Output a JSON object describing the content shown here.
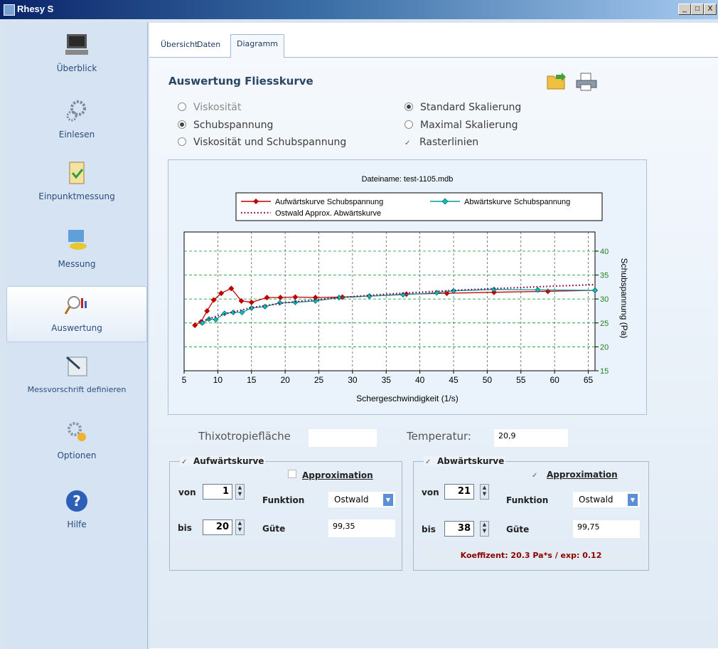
{
  "window": {
    "title": "Rhesy S",
    "controls": [
      "_",
      "□",
      "X"
    ]
  },
  "sidebar": {
    "items": [
      {
        "label": "Überblick",
        "icon": "computer-icon"
      },
      {
        "label": "Einlesen",
        "icon": "gears-icon"
      },
      {
        "label": "Einpunktmessung",
        "icon": "clipboard-check-icon"
      },
      {
        "label": "Messung",
        "icon": "measurement-icon"
      },
      {
        "label": "Auswertung",
        "icon": "analysis-chart-icon",
        "active": true
      },
      {
        "label": "Messvorschrift definieren",
        "icon": "document-pen-icon"
      },
      {
        "label": "Optionen",
        "icon": "settings-gears-icon"
      },
      {
        "label": "Hilfe",
        "icon": "help-icon"
      }
    ]
  },
  "tabs": [
    {
      "label": "Übersicht"
    },
    {
      "label": "Daten"
    },
    {
      "label": "Diagramm",
      "active": true
    }
  ],
  "content": {
    "heading": "Auswertung Fliesskurve",
    "options_left": [
      {
        "label": "Viskosität",
        "selected": false,
        "enabled": false
      },
      {
        "label": "Schubspannung",
        "selected": true,
        "enabled": true
      },
      {
        "label": "Viskosität und Schubspannung",
        "selected": false,
        "enabled": true
      }
    ],
    "options_right": [
      {
        "label": "Standard Skalierung",
        "selected": true
      },
      {
        "label": "Maximal Skalierung",
        "selected": false
      },
      {
        "label": "Rasterlinien",
        "checked": true
      }
    ]
  },
  "chart_data": {
    "type": "line",
    "title": "Dateiname: test-1105.mdb",
    "xlabel": "Schergeschwindigkeit (1/s)",
    "ylabel": "Schubspannung (Pa)",
    "xlim": [
      5,
      66
    ],
    "ylim": [
      15,
      44
    ],
    "x_ticks": [
      5,
      10,
      15,
      20,
      25,
      30,
      35,
      40,
      45,
      50,
      55,
      60,
      65
    ],
    "y_ticks": [
      15,
      20,
      25,
      30,
      35,
      40
    ],
    "y_axis_side": "right",
    "grid": true,
    "legend_position": "top",
    "series": [
      {
        "name": "Aufwärtskurve Schubspannung",
        "color": "#c00000",
        "marker": "diamond",
        "x": [
          6.6,
          7.5,
          8.4,
          9.4,
          10.5,
          12,
          13.5,
          15,
          17.3,
          19.3,
          21.5,
          24.5,
          28.5,
          32.5,
          38,
          44,
          51,
          59,
          66
        ],
        "y": [
          24.5,
          25.2,
          27.5,
          29.8,
          31.2,
          32.2,
          29.6,
          29.3,
          30.3,
          30.3,
          30.4,
          30.3,
          30.4,
          30.6,
          31,
          31.2,
          31.4,
          31.6,
          31.8
        ]
      },
      {
        "name": "Abwärtskurve Schubspannung",
        "color": "#00a0a0",
        "marker": "diamond",
        "x": [
          7.7,
          8.7,
          9.7,
          11,
          12.3,
          13.6,
          15,
          17,
          19.2,
          21.5,
          24.5,
          28,
          32.5,
          37.5,
          42.5,
          45,
          51,
          57.5,
          66
        ],
        "y": [
          25,
          25.8,
          25.7,
          27,
          27.2,
          27.2,
          28.1,
          28.4,
          29.2,
          29.3,
          29.6,
          30.3,
          30.6,
          30.9,
          31.3,
          31.7,
          32,
          31.9,
          31.8
        ]
      },
      {
        "name": "Ostwald Approx. Abwärtskurve",
        "color": "#800040",
        "style": "dotted",
        "x": [
          7.7,
          10,
          15,
          20,
          25,
          30,
          35,
          40,
          45,
          50,
          55,
          60,
          66
        ],
        "y": [
          25.4,
          26.5,
          28.2,
          29.2,
          29.9,
          30.5,
          31,
          31.4,
          31.8,
          32.1,
          32.4,
          32.7,
          33
        ]
      }
    ]
  },
  "bottom": {
    "thixo_label": "Thixotropiefläche",
    "thixo_value": "",
    "temp_label": "Temperatur:",
    "temp_value": "20,9",
    "aufwaerts": {
      "title": "Aufwärtskurve",
      "checked": true,
      "approx_label": "Approximation",
      "approx_checked": false,
      "von_label": "von",
      "von_value": "1",
      "bis_label": "bis",
      "bis_value": "20",
      "funktion_label": "Funktion",
      "funktion_value": "Ostwald",
      "guete_label": "Güte",
      "guete_value": "99,35",
      "status": ""
    },
    "abwaerts": {
      "title": "Abwärtskurve",
      "checked": true,
      "approx_label": "Approximation",
      "approx_checked": true,
      "von_label": "von",
      "von_value": "21",
      "bis_label": "bis",
      "bis_value": "38",
      "funktion_label": "Funktion",
      "funktion_value": "Ostwald",
      "guete_label": "Güte",
      "guete_value": "99,75",
      "status": "Koeffizent: 20.3 Pa*s / exp: 0.12"
    }
  }
}
